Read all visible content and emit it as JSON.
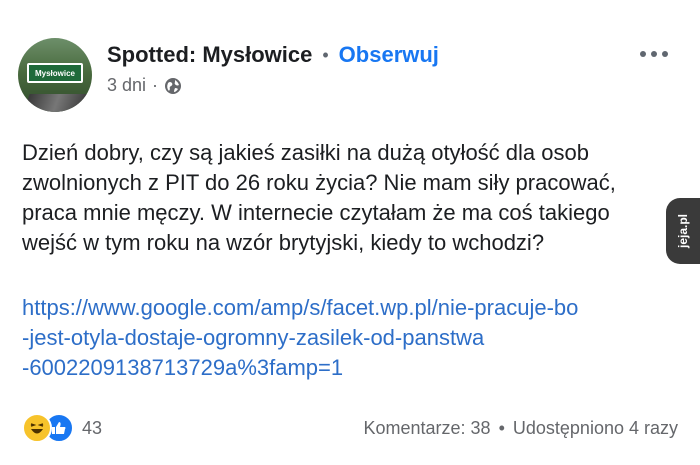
{
  "post": {
    "author": "Spotted: Mysłowice",
    "separator": "•",
    "follow_label": "Obserwuj",
    "time": "3 dni",
    "time_sep": "·",
    "privacy_icon": "globe-icon",
    "avatar_sign_text": "Mysłowice",
    "text": "Dzień dobry, czy są jakieś zasiłki na dużą otyłość dla osob\nzwolnionych z PIT do 26 roku życia? Nie mam siły pracować,\npraca mnie męczy. W internecie czytałam że ma coś takiego\nwejść w tym roku na wzór brytyjski, kiedy to wchodzi?",
    "link": "https://www.google.com/amp/s/facet.wp.pl/nie-pracuje-bo\n-jest-otyla-dostaje-ogromny-zasilek-od-panstwa\n-6002209138713729a%3famp=1"
  },
  "footer": {
    "reaction_count": "43",
    "comments": "Komentarze: 38",
    "bullet": "•",
    "shares": "Udostępniono 4 razy"
  },
  "watermark": "jeja.pl",
  "colors": {
    "accent": "#1877f2",
    "link": "#2d6ec8",
    "muted": "#65676b",
    "haha": "#f7c32b"
  }
}
